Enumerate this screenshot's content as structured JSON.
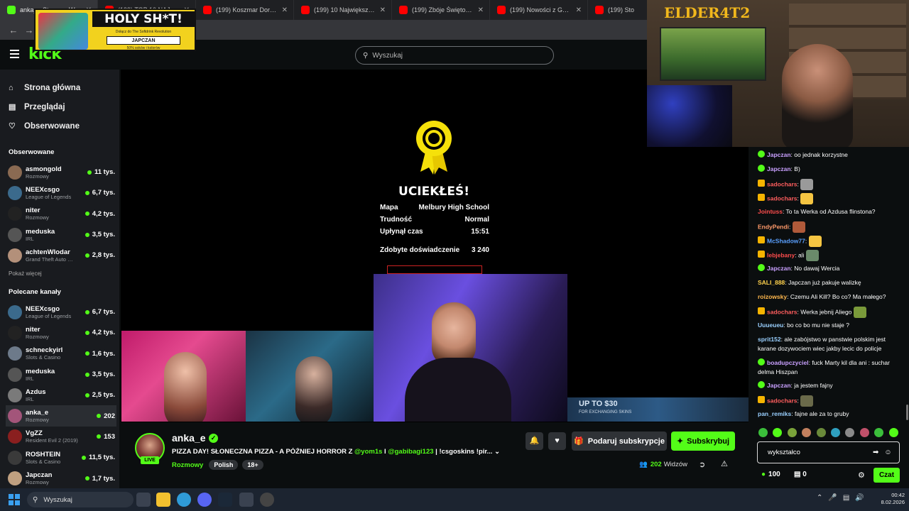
{
  "browser": {
    "tabs": [
      {
        "title": "anka_e Stream - Wat…",
        "fav": "kick",
        "active": true
      },
      {
        "title": "(199) TOP 10 NAJGORSZ…",
        "fav": "yt"
      },
      {
        "title": "(199) Koszmar Dorosłości…",
        "fav": "yt"
      },
      {
        "title": "(199) 10 Największych Dz…",
        "fav": "yt"
      },
      {
        "title": "(199) Zbóje Świętokrzysc…",
        "fav": "yt"
      },
      {
        "title": "(199) Nowości z Gothic R…",
        "fav": "yt"
      },
      {
        "title": "(199) Sto",
        "fav": "yt"
      }
    ]
  },
  "ad": {
    "title": "HOLY SH*T!",
    "subtitle": "Dołącz do The Softdrink Revolution",
    "brand": "JAPCZAN",
    "note": "50% soków i kolorów"
  },
  "header": {
    "logo": "kick",
    "search_placeholder": "Wyszukaj"
  },
  "nav": {
    "items": [
      {
        "label": "Strona główna",
        "icon": "home-icon"
      },
      {
        "label": "Przeglądaj",
        "icon": "browse-icon"
      },
      {
        "label": "Obserwowane",
        "icon": "heart-icon"
      }
    ]
  },
  "sidebar": {
    "followed_title": "Obserwowane",
    "show_more": "Pokaż więcej",
    "recommended_title": "Polecane kanały",
    "followed": [
      {
        "name": "asmongold",
        "category": "Rozmowy",
        "viewers": "11 tys.",
        "color": "#8a6a52"
      },
      {
        "name": "NEEXcsgo",
        "category": "League of Legends",
        "viewers": "6,7 tys.",
        "color": "#3b6a8c"
      },
      {
        "name": "niter",
        "category": "Rozmowy",
        "viewers": "4,2 tys.",
        "color": "#222222"
      },
      {
        "name": "meduska",
        "category": "IRL",
        "viewers": "3,5 tys.",
        "color": "#555555"
      },
      {
        "name": "achtenWlodar",
        "category": "Grand Theft Auto …",
        "viewers": "2,8 tys.",
        "color": "#b3907a"
      }
    ],
    "recommended": [
      {
        "name": "NEEXcsgo",
        "category": "League of Legends",
        "viewers": "6,7 tys.",
        "color": "#3b6a8c"
      },
      {
        "name": "niter",
        "category": "Rozmowy",
        "viewers": "4,2 tys.",
        "color": "#222222"
      },
      {
        "name": "schneckyirl",
        "category": "Slots & Casino",
        "viewers": "1,6 tys.",
        "color": "#6d7a8a"
      },
      {
        "name": "meduska",
        "category": "IRL",
        "viewers": "3,5 tys.",
        "color": "#555555"
      },
      {
        "name": "Azdus",
        "category": "IRL",
        "viewers": "2,5 tys.",
        "color": "#7a7a7a"
      },
      {
        "name": "anka_e",
        "category": "Rozmowy",
        "viewers": "202",
        "color": "#a3557a",
        "selected": true
      },
      {
        "name": "VgZZ",
        "category": "Resident Evil 2 (2019)",
        "viewers": "153",
        "color": "#8a1f1f"
      },
      {
        "name": "ROSHTEIN",
        "category": "Slots & Casino",
        "viewers": "11,5 tys.",
        "color": "#3a3a3a"
      },
      {
        "name": "Japczan",
        "category": "Rozmowy",
        "viewers": "1,7 tys.",
        "color": "#c0a080"
      }
    ]
  },
  "game": {
    "escaped": "UCIEKŁEŚ!",
    "stats": [
      {
        "label": "Mapa",
        "value": "Melbury High School"
      },
      {
        "label": "Trudność",
        "value": "Normal"
      },
      {
        "label": "Upłynął czas",
        "value": "15:51"
      }
    ],
    "xp_label": "Zdobyte doświadczenie",
    "xp_value": "3 240",
    "promo": "UP TO $30",
    "promo_sub": "FOR EXCHANGING SKINS"
  },
  "channel": {
    "name": "anka_e",
    "live": "LIVE",
    "title_a": "PIZZA DAY! SŁONECZNA PIZZA - A PÓŹNIEJ HORROR Z ",
    "mention1": "@yom1s",
    "title_b": " I ",
    "mention2": "@gabibagi123",
    "title_c": " | !csgoskins !pir...",
    "category": "Rozmowy",
    "tags": [
      "Polish",
      "18+"
    ],
    "gift_label": "Podaruj subskrypcje",
    "sub_label": "Subskrybuj",
    "viewers": "202",
    "viewers_label": "Widzów"
  },
  "webcam": {
    "logo": "ELDER4T2"
  },
  "chat": {
    "messages": [
      {
        "user": "Japczan",
        "color": "#c9a0ff",
        "badge": "g",
        "text": "oo jednak korzystne"
      },
      {
        "user": "Japczan",
        "color": "#c9a0ff",
        "badge": "g",
        "text": "B)"
      },
      {
        "user": "sadochars",
        "color": "#ff5e5e",
        "badge": "y",
        "text": "",
        "emote": "#9a9a9a"
      },
      {
        "user": "sadochars",
        "color": "#ff5e5e",
        "badge": "y",
        "text": "",
        "emote": "#f5c542"
      },
      {
        "user": "Jointuss",
        "color": "#ff4d4d",
        "badge": "",
        "text": "To ta Werka od Azdusa flinstona?"
      },
      {
        "user": "EndyPendi",
        "color": "#ff9a6a",
        "badge": "",
        "text": "",
        "emote": "#b05a3a"
      },
      {
        "user": "McShadow77",
        "color": "#5aa0ff",
        "badge": "y",
        "text": "",
        "emote": "#f5c542"
      },
      {
        "user": "lebjebany",
        "color": "#ff4d4d",
        "badge": "y",
        "text": "ali",
        "emote": "#6a8a6a"
      },
      {
        "user": "Japczan",
        "color": "#c9a0ff",
        "badge": "g",
        "text": "No dawaj Wercia"
      },
      {
        "user": "SALI_888",
        "color": "#ffd24d",
        "badge": "",
        "text": "Japczan już pakuje walizkę"
      },
      {
        "user": "roizowsky",
        "color": "#ffb84d",
        "badge": "",
        "text": "Czemu Ali Kill? Bo co? Ma małego?"
      },
      {
        "user": "sadochars",
        "color": "#ff5e5e",
        "badge": "y",
        "text": "Werka jebnij Aliego",
        "emote": "#7a9a3a"
      },
      {
        "user": "Uuueueu",
        "color": "#9ad0ff",
        "badge": "",
        "text": "bo co bo mu nie staje ?"
      },
      {
        "user": "sprit152",
        "color": "#9ad0ff",
        "badge": "",
        "text": "ale zabójstwo w panstwie polskim jest karane dozywociem wiec jakby lecic do policje"
      },
      {
        "user": "boadupczyciel",
        "color": "#c9a0ff",
        "badge": "g",
        "text": "fuck Marty kil dla ani : suchar delma Hiszpan"
      },
      {
        "user": "Japczan",
        "color": "#c9a0ff",
        "badge": "g",
        "text": "ja jestem fajny"
      },
      {
        "user": "sadochars",
        "color": "#ff5e5e",
        "badge": "y",
        "text": "",
        "emote": "#6a6a4a"
      },
      {
        "user": "pan_remiks",
        "color": "#9ad0ff",
        "badge": "",
        "text": "fajne ale za to gruby"
      }
    ],
    "input_value": "wykształco",
    "points": "100",
    "box_count": "0",
    "send_label": "Czat"
  },
  "taskbar": {
    "search": "Wyszukaj",
    "time": "00:42",
    "date": "8.02.2026"
  }
}
